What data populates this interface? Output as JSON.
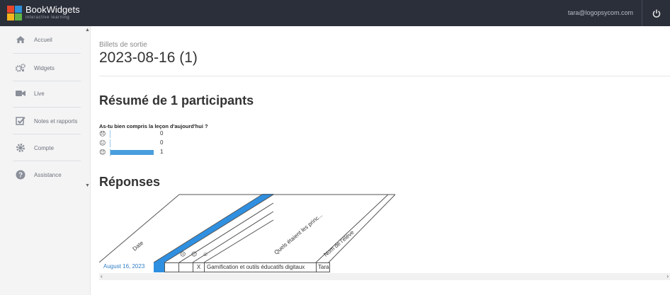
{
  "app": {
    "brand": "BookWidgets",
    "tagline": "interactive learning",
    "user_email": "tara@logopsycom.com"
  },
  "sidebar": {
    "items": [
      {
        "label": "Accueil",
        "icon": "home-icon"
      },
      {
        "label": "Widgets",
        "icon": "gears-icon"
      },
      {
        "label": "Live",
        "icon": "video-camera-icon"
      },
      {
        "label": "Notes et rapports",
        "icon": "checkbox-icon"
      },
      {
        "label": "Compte",
        "icon": "gear-icon"
      },
      {
        "label": "Assistance",
        "icon": "question-icon"
      }
    ]
  },
  "main": {
    "breadcrumb": "Billets de sortie",
    "title": "2023-08-16 (1)",
    "summary_title": "Résumé de 1 participants",
    "question": "As-tu bien compris la leçon d'aujourd'hui ?",
    "responses_title": "Réponses"
  },
  "chart_data": {
    "type": "bar",
    "orientation": "horizontal",
    "title": "As-tu bien compris la leçon d'aujourd'hui ?",
    "categories": [
      "😞",
      "😐",
      "😊"
    ],
    "values": [
      0,
      0,
      1
    ],
    "xlim": [
      0,
      1
    ],
    "color": "#4a9edd"
  },
  "responses_table": {
    "headers": [
      "Date",
      "As-tu bien compris la l...",
      "☹",
      "😐",
      "☺",
      "Quels étaient les princ...",
      "Nom de l'élève"
    ],
    "row": {
      "date": "August 16, 2023",
      "mark": "X",
      "answer": "Gamification et outils éducatifs digitaux",
      "name": "Tara"
    },
    "highlight_color": "#2f8fe0"
  }
}
